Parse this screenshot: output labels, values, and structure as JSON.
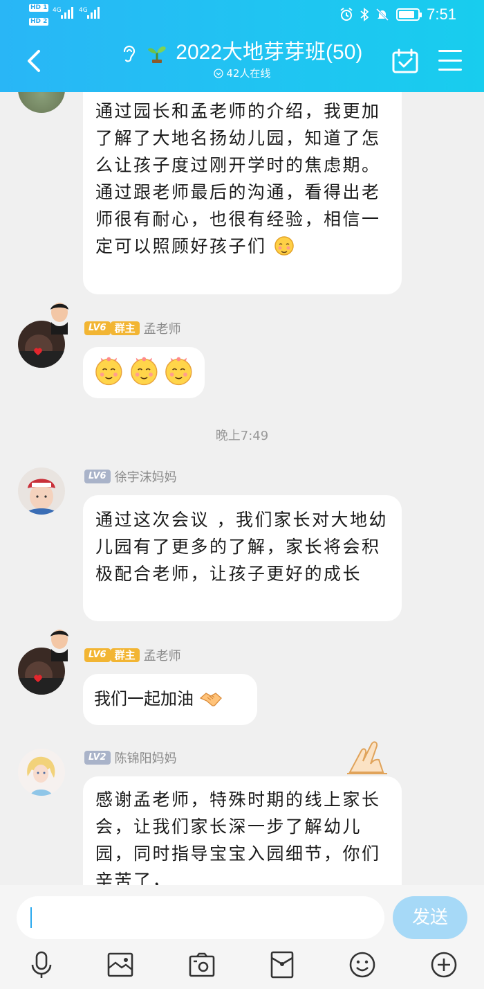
{
  "status_bar": {
    "sim1_tag": "HD 1",
    "sim2_tag": "HD 2",
    "net1": "4G",
    "net2": "4G",
    "time": "7:51",
    "battery_level": 0.85
  },
  "header": {
    "title": "2022大地芽芽班(50)",
    "online": "42人在线"
  },
  "messages": [
    {
      "text": "通过园长和孟老师的介绍，我更加了解了大地名扬幼儿园，知道了怎么让孩子度过刚开学时的焦虑期。通过跟老师最后的沟通，看得出老师很有耐心，也很有经验，相信一定可以照顾好孩子们"
    },
    {
      "level": "LV6",
      "role": "群主",
      "sender": "孟老师",
      "emoji_count": 3
    },
    {
      "timestamp": "晚上7:49"
    },
    {
      "level": "LV6",
      "sender": "徐宇沫妈妈",
      "text": "通过这次会议 ，我们家长对大地幼儿园有了更多的了解，家长将会积极配合老师，让孩子更好的成长"
    },
    {
      "level": "LV6",
      "role": "群主",
      "sender": "孟老师",
      "text": "我们一起加油"
    },
    {
      "level": "LV2",
      "sender": "陈锦阳妈妈",
      "text": "感谢孟老师，特殊时期的线上家长会，让我们家长深一步了解幼儿园，同时指导宝宝入园细节，你们辛苦了，"
    }
  ],
  "input": {
    "send_label": "发送"
  },
  "toolbar_icons": [
    "microphone-icon",
    "image-icon",
    "camera-icon",
    "red-packet-icon",
    "emoji-icon",
    "plus-icon"
  ],
  "colors": {
    "header_start": "#29b6f6",
    "header_end": "#18cdee",
    "send_button": "#a6d9f7",
    "level_badge": "#f2b533",
    "level_badge_grey": "#a9b3c9"
  }
}
